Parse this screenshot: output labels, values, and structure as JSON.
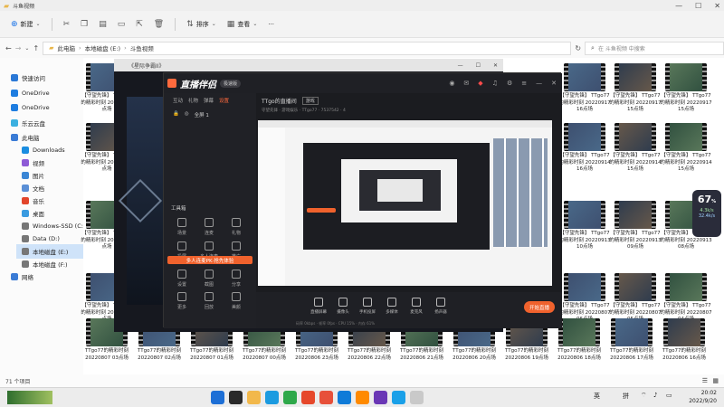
{
  "window": {
    "title": "斗鱼视频",
    "controls": [
      "—",
      "☐",
      "✕"
    ]
  },
  "toolbar": {
    "new_label": "新建",
    "sort_label": "排序",
    "view_label": "查看",
    "more_label": "···"
  },
  "address": {
    "path": [
      "此电脑",
      "本地磁盘 (E:)",
      "斗鱼视频"
    ],
    "search_placeholder": "在 斗鱼视频 中搜索"
  },
  "sidebar": {
    "items": [
      {
        "label": "快速访问",
        "icon": "star-icon",
        "color": "#2a78d6"
      },
      {
        "label": "OneDrive",
        "icon": "cloud-icon",
        "color": "#1e7de0"
      },
      {
        "label": "OneDrive",
        "icon": "cloud-icon",
        "color": "#1e7de0"
      },
      {
        "label": "乐云云盘",
        "icon": "cloud-icon",
        "color": "#3bb0e0"
      },
      {
        "label": "此电脑",
        "icon": "computer-icon",
        "color": "#3a7bd5"
      },
      {
        "label": "Downloads",
        "icon": "download-icon",
        "color": "#1a8de0"
      },
      {
        "label": "视频",
        "icon": "video-icon",
        "color": "#8e5bd6"
      },
      {
        "label": "图片",
        "icon": "picture-icon",
        "color": "#3a86d5"
      },
      {
        "label": "文档",
        "icon": "document-icon",
        "color": "#5a8fd6"
      },
      {
        "label": "音乐",
        "icon": "music-icon",
        "color": "#e2452b"
      },
      {
        "label": "桌面",
        "icon": "desktop-icon",
        "color": "#3a9be0"
      },
      {
        "label": "Windows-SSD (C:)",
        "icon": "drive-icon",
        "color": "#777777"
      },
      {
        "label": "Data (D:)",
        "icon": "drive-icon",
        "color": "#777777"
      },
      {
        "label": "本地磁盘 (E:)",
        "icon": "drive-icon",
        "color": "#777777"
      },
      {
        "label": "本地磁盘 (F:)",
        "icon": "drive-icon",
        "color": "#777777"
      },
      {
        "label": "网络",
        "icon": "network-icon",
        "color": "#3a7bd5"
      }
    ]
  },
  "files": {
    "right_cols": [
      [
        "【守望先锋】 TTgo77的精彩时刻 20220917 16点场",
        "【守望先锋】 TTgo77的精彩时刻 20220917 15点场",
        "【守望先锋】 TTgo77的精彩时刻 20220917 15点场"
      ],
      [
        "【守望先锋】 TTgo77的精彩时刻 20220914 16点场",
        "【守望先锋】 TTgo77的精彩时刻 20220914 15点场",
        "【守望先锋】 TTgo77的精彩时刻 20220914 15点场"
      ],
      [
        "【守望先锋】 TTgo77的精彩时刻 20220913 10点场",
        "【守望先锋】 TTgo77的精彩时刻 20220913 09点场",
        "【守望先锋】 TTgo77的精彩时刻 20220913 08点场"
      ],
      [
        "【守望先锋】 TTgo77的精彩时刻 20220807 06点场",
        "【守望先锋】 TTgo77的精彩时刻 20220807 05点场",
        "【守望先锋】 TTgo77的精彩时刻 20220807 04点场"
      ]
    ],
    "left_col": [
      "【守望先锋】 TTgo77的精彩时刻 20220917 点场",
      "【守望先锋】 TTgo77的精彩时刻 20220914 点场",
      "【守望先锋】 TTgo77的精彩时刻 20220913 点场",
      "【守望先锋】 TTgo77的精彩时刻 20220807 点场"
    ],
    "bottom_row": [
      "TTgo77的精彩时刻 20220807 03点场",
      "TTgo77的精彩时刻 20220807 02点场",
      "TTgo77的精彩时刻 20220807 01点场",
      "TTgo77的精彩时刻 20220807 00点场",
      "TTgo77的精彩时刻 20220806 23点场",
      "TTgo77的精彩时刻 20220806 22点场",
      "TTgo77的精彩时刻 20220806 21点场",
      "TTgo77的精彩时刻 20220806 20点场",
      "TTgo77的精彩时刻 20220806 19点场",
      "TTgo77的精彩时刻 20220806 18点场",
      "TTgo77的精彩时刻 20220806 17点场",
      "TTgo77的精彩时刻 20220806 16点场"
    ]
  },
  "status": {
    "count": "71 个项目"
  },
  "overlay_window": {
    "title": "《星际争霸II》"
  },
  "streamer_app": {
    "logo": "直播伴侣",
    "version_tag": "极速版",
    "nav": [
      "互动",
      "礼物",
      "弹幕",
      "设置"
    ],
    "scene_label": "全屏 1",
    "room_title": "TTgo的直播间",
    "room_tag": "游戏",
    "room_meta": "守望先锋 · 游戏娱乐 · TTgo77 · 7537542 · 4",
    "tools_title": "工具箱",
    "tools": [
      "场景",
      "连麦",
      "礼物",
      "投屏",
      "多人连麦",
      "推广",
      "设置",
      "截图",
      "分享",
      "更多",
      "回放",
      "美颜"
    ],
    "promo_text": "多人连麦PK·抢先体验",
    "bottom_items": [
      "直播屏幕",
      "摄像头",
      "手机投屏",
      "多媒体",
      "麦克风",
      "扬声器"
    ],
    "start_label": "开始直播",
    "stats": "码率 0kbps · 帧率 0fps · CPU 15% · 内存 61%"
  },
  "floating_widget": {
    "value": "67",
    "unit": "%",
    "up": "4.3k/s",
    "down": "32.4k/s"
  },
  "taskbar": {
    "tray": [
      "英",
      "拼"
    ],
    "time": "20:02",
    "date": "2022/9/20",
    "icon_colors": [
      "#1d6fd6",
      "#2a2a2a",
      "#f2b84b",
      "#1c9be0",
      "#2ea84a",
      "#e6482b",
      "#e7503a",
      "#0f7bd8",
      "#ff8a00",
      "#6a37b5",
      "#1aa0e8",
      "#c9c9c9"
    ]
  }
}
